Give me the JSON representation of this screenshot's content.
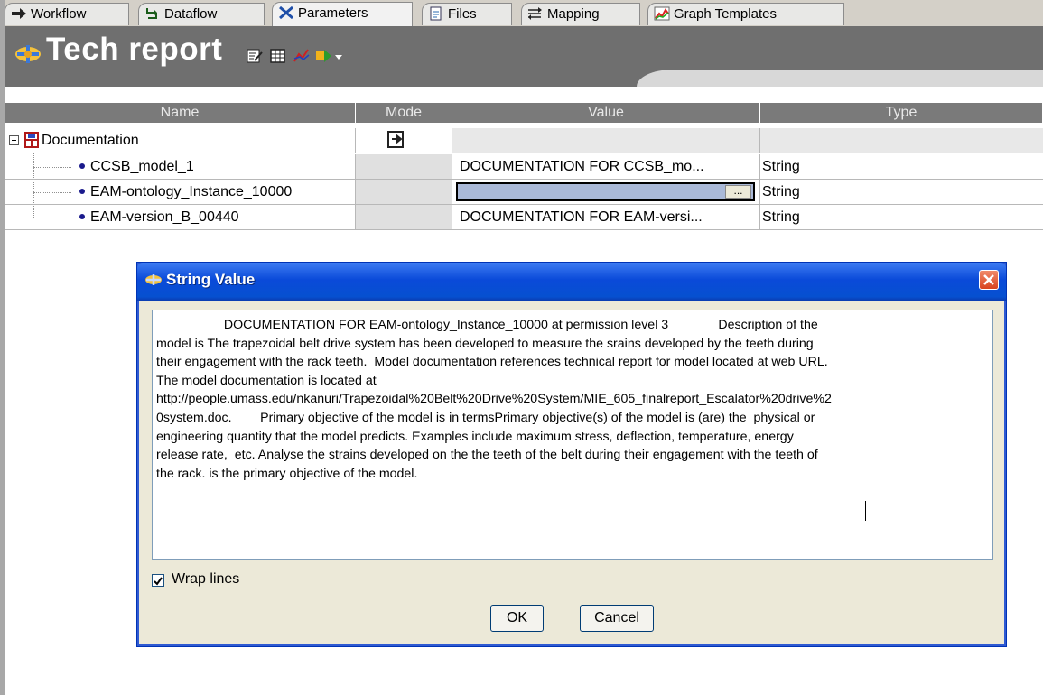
{
  "tabs": [
    {
      "label": "Workflow",
      "icon": "arrow-right-icon"
    },
    {
      "label": "Dataflow",
      "icon": "dataflow-icon"
    },
    {
      "label": "Parameters",
      "icon": "parameters-icon",
      "active": true
    },
    {
      "label": "Files",
      "icon": "files-icon"
    },
    {
      "label": "Mapping",
      "icon": "mapping-icon"
    },
    {
      "label": "Graph Templates",
      "icon": "chart-icon"
    }
  ],
  "header": {
    "title": "Tech report",
    "toolbar_icons": [
      "edit-icon",
      "table-icon",
      "graph-icon",
      "run-icon"
    ]
  },
  "table": {
    "columns": [
      "Name",
      "Mode",
      "Value",
      "Type"
    ],
    "group": {
      "name": "Documentation"
    },
    "rows": [
      {
        "name": "CCSB_model_1",
        "value": "DOCUMENTATION FOR CCSB_mo...",
        "type": "String"
      },
      {
        "name": "EAM-ontology_Instance_10000",
        "value": "",
        "type": "String",
        "edit_button": "..."
      },
      {
        "name": "EAM-version_B_00440",
        "value": "DOCUMENTATION FOR EAM-versi...",
        "type": "String"
      }
    ]
  },
  "dialog": {
    "title": "String Value",
    "text_lines": [
      "                   DOCUMENTATION FOR EAM-ontology_Instance_10000 at permission level 3              Description of the",
      "model is The trapezoidal belt drive system has been developed to measure the srains developed by the teeth during",
      "their engagement with the rack teeth.  Model documentation references technical report for model located at web URL.",
      "The model documentation is located at",
      "http://people.umass.edu/nkanuri/Trapezoidal%20Belt%20Drive%20System/MIE_605_finalreport_Escalator%20drive%2",
      "0system.doc.        Primary objective of the model is in termsPrimary objective(s) of the model is (are) the  physical or",
      "engineering quantity that the model predicts. Examples include maximum stress, deflection, temperature, energy",
      "release rate,  etc. Analyse the strains developed on the the teeth of the belt during their engagement with the teeth of",
      "the rack. is the primary objective of the model."
    ],
    "wrap_lines_label": "Wrap lines",
    "wrap_lines_checked": true,
    "ok_label": "OK",
    "cancel_label": "Cancel"
  },
  "colors": {
    "header_bg": "#6f6f6f",
    "title_bar": "#0a4ad9",
    "close_button": "#d8431e"
  }
}
